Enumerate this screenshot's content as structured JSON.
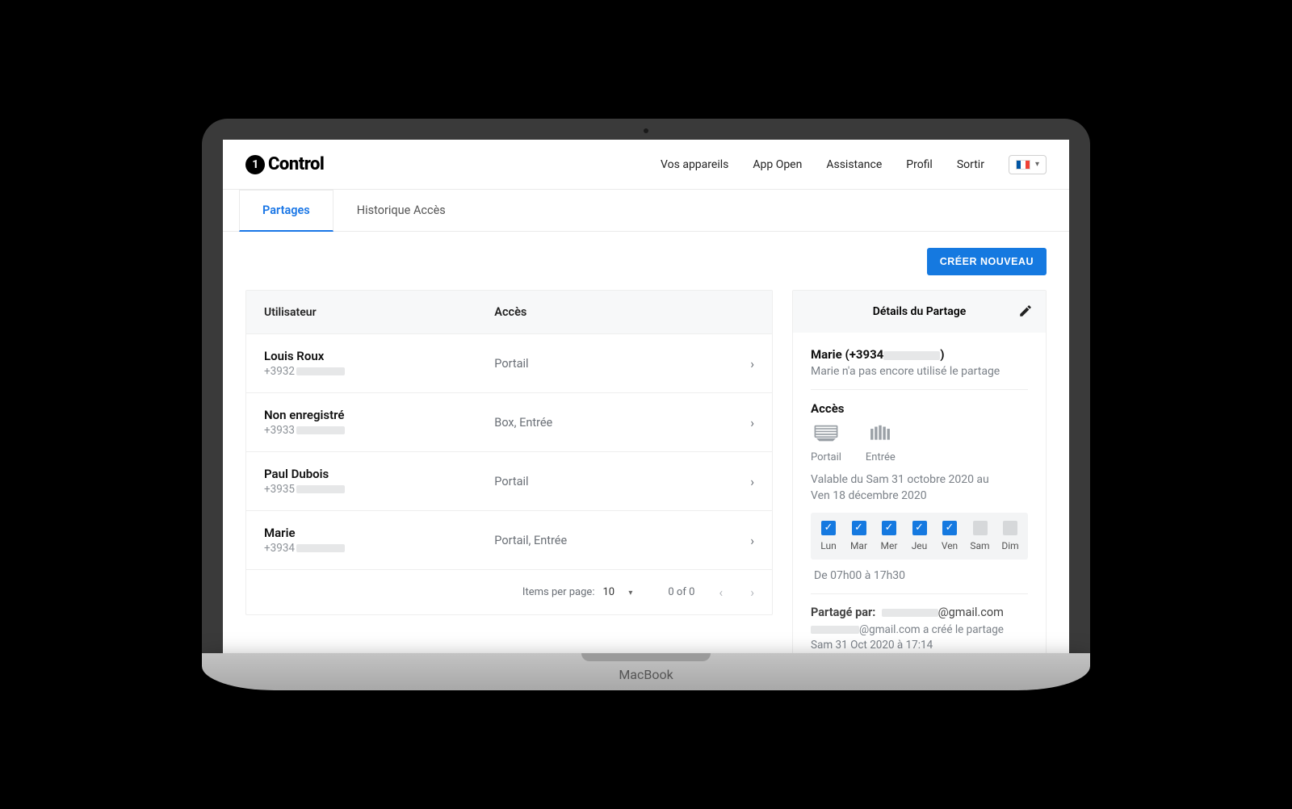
{
  "brand": "Control",
  "nav": {
    "devices": "Vos appareils",
    "app_open": "App Open",
    "assistance": "Assistance",
    "profile": "Profil",
    "logout": "Sortir"
  },
  "tabs": {
    "shares": "Partages",
    "history": "Historique Accès"
  },
  "actions": {
    "create_new": "CRÉER  NOUVEAU"
  },
  "table": {
    "header_user": "Utilisateur",
    "header_access": "Accès",
    "rows": [
      {
        "name": "Louis Roux",
        "phone_prefix": "+3932",
        "access": "Portail"
      },
      {
        "name": "Non enregistré",
        "phone_prefix": "+3933",
        "access": "Box, Entrée"
      },
      {
        "name": "Paul Dubois",
        "phone_prefix": "+3935",
        "access": "Portail"
      },
      {
        "name": "Marie",
        "phone_prefix": "+3934",
        "access": "Portail, Entrée"
      }
    ],
    "pager": {
      "items_per_page_label": "Items per page:",
      "items_per_page_value": "10",
      "range": "0 of 0"
    }
  },
  "details": {
    "title": "Détails du Partage",
    "user_label": "Marie (+3934",
    "user_tail": ")",
    "status": "Marie n'a pas encore utilisé le partage",
    "access_title": "Accès",
    "access_items": [
      {
        "label": "Portail"
      },
      {
        "label": "Entrée"
      }
    ],
    "validity_line1": "Valable du Sam 31 octobre 2020 au",
    "validity_line2": "Ven 18 décembre 2020",
    "days": [
      {
        "label": "Lun",
        "on": true
      },
      {
        "label": "Mar",
        "on": true
      },
      {
        "label": "Mer",
        "on": true
      },
      {
        "label": "Jeu",
        "on": true
      },
      {
        "label": "Ven",
        "on": true
      },
      {
        "label": "Sam",
        "on": false
      },
      {
        "label": "Dim",
        "on": false
      }
    ],
    "hours": "De 07h00 à 17h30",
    "shared_by_label": "Partagé par:",
    "shared_by_value_suffix": "@gmail.com",
    "meta_line1_suffix": "@gmail.com a créé le partage",
    "meta_line2": "Sam 31 Oct 2020 à 17:14"
  },
  "frame": {
    "base_label": "MacBook"
  }
}
